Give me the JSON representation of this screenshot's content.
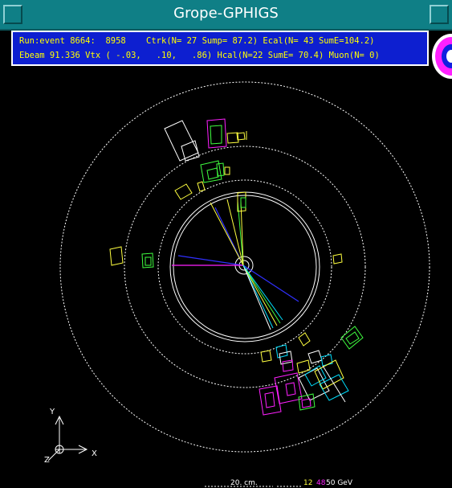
{
  "window": {
    "title": "Grope-GPHIGS"
  },
  "info": {
    "line1": "Run:event 8664:  8958    Ctrk(N= 27 Sump= 87.2) Ecal(N= 43 SumE=104.2)",
    "line2": "Ebeam 91.336 Vtx ( -.03,   .10,   .86) Hcal(N=22 SumE= 70.4) Muon(N= 0)"
  },
  "axes": {
    "y": "Y",
    "x": "X",
    "z": "Z"
  },
  "scale": {
    "distance": "20. cm.",
    "energy_a": "12",
    "energy_b": "48",
    "energy_unit": "50 GeV"
  },
  "colors": {
    "title_bar": "#0f7f86",
    "info_bg": "#0d1fd0",
    "info_text": "#ffff00",
    "track_blue": "#3030ff",
    "track_magenta": "#ff20ff",
    "cluster_green": "#40ff40",
    "cluster_yellow": "#ffff40",
    "cluster_cyan": "#00e0ff"
  }
}
